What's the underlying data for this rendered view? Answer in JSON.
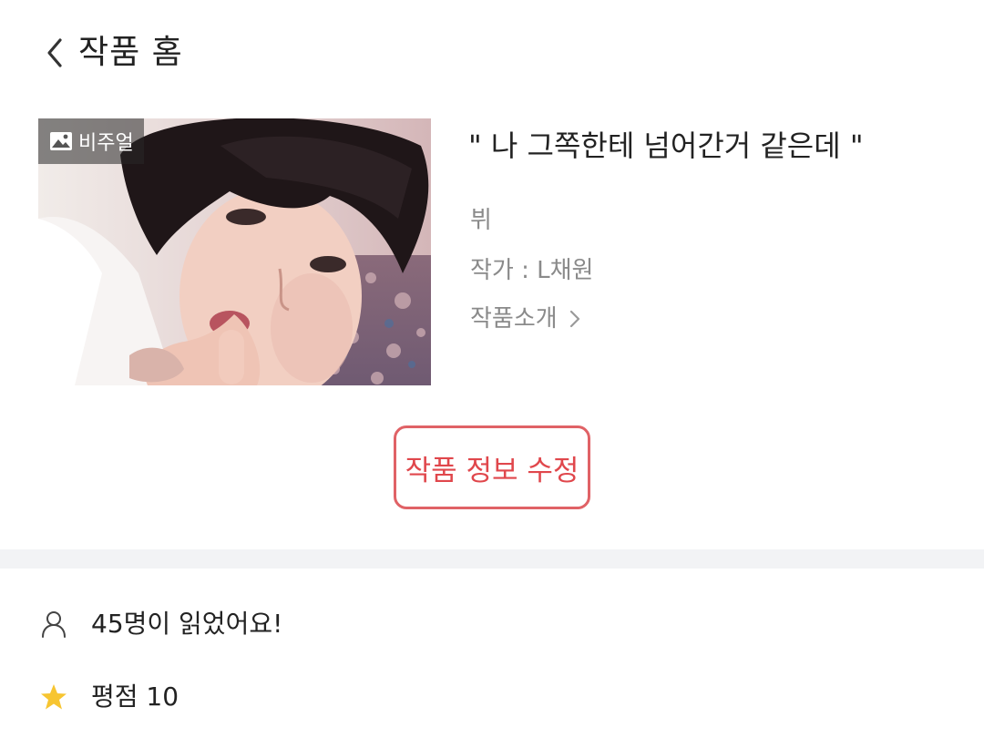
{
  "header": {
    "back_icon": "chevron-left-icon",
    "title": "작품 홈"
  },
  "work": {
    "badge_icon": "image-icon",
    "badge_label": "비주얼",
    "title": "\" 나 그쪽한테 넘어간거 같은데  \"",
    "genre": "뷔",
    "author": "작가 : L채원",
    "intro_label": "작품소개",
    "intro_icon": "chevron-right-icon"
  },
  "edit_button": {
    "label": "작품 정보 수정",
    "color": "#e0474c"
  },
  "stats": {
    "readers_icon": "user-icon",
    "readers_text": "45명이 읽었어요!",
    "rating_icon": "star-icon",
    "rating_text": "평점 10",
    "star_color": "#f7c531"
  }
}
